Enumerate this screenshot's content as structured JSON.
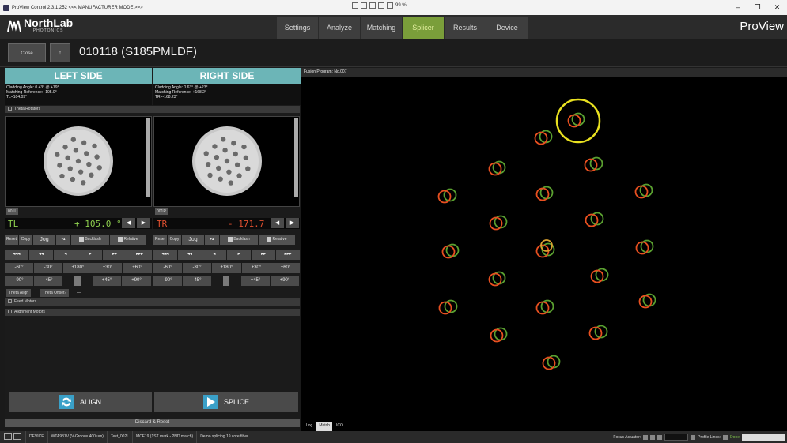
{
  "window": {
    "title": "ProView Control 2.3.1.252 <<< MANUFACTURER MODE >>>",
    "tray_text": "99 %"
  },
  "header": {
    "brand": "NorthLab",
    "brand_sub": "PHOTONICS",
    "app_name": "ProView",
    "tabs": [
      {
        "label": "Settings",
        "active": false
      },
      {
        "label": "Analyze",
        "active": false
      },
      {
        "label": "Matching",
        "active": false
      },
      {
        "label": "Splicer",
        "active": true
      },
      {
        "label": "Results",
        "active": false
      },
      {
        "label": "Device",
        "active": false
      }
    ]
  },
  "subheader": {
    "close_label": "Close",
    "up_label": "↑",
    "fiber_title": "010118 (S185PMLDF)"
  },
  "left": {
    "header": "LEFT SIDE",
    "info": [
      "Cladding Angle: 0.43° @ +19°",
      "Matching Reference: -105.0°",
      "TL=104.09°"
    ],
    "cam_label": "001L",
    "axis": "TL",
    "value": "+ 105.0 °",
    "value_color": "#8fd14f"
  },
  "right": {
    "header": "RIGHT SIDE",
    "info": [
      "Cladding Angle: 0.63° @ +23°",
      "Matching Reference: +168.2°",
      "TR=-168.23°"
    ],
    "cam_label": "001R",
    "axis": "TR",
    "value": "- 171.7 °",
    "value_color": "#e05030"
  },
  "theta_rotators": "Theta Rotators",
  "controls": {
    "reset": "Reset",
    "copy": "Copy",
    "jog": "Jog",
    "backlash": "Backlash",
    "relative": "Relative",
    "steps": [
      "◂◂◂",
      "◂◂",
      "◂",
      "▸",
      "▸▸",
      "▸▸▸"
    ],
    "row_a": [
      "-60°",
      "-30°",
      "±180°",
      "+30°",
      "+60°"
    ],
    "row_b": [
      "-90°",
      "-45°",
      "",
      "+45°",
      "+90°"
    ]
  },
  "theta_tabs": [
    "Theta Align",
    "Theta Offset?",
    "—"
  ],
  "feed_motors": "Feed Motors",
  "alignment_motors": "Alignment Motors",
  "buttons": {
    "align": "ALIGN",
    "splice": "SPLICE",
    "discard": "Discard & Reset"
  },
  "fusion": {
    "program": "Fusion Program:  No.007",
    "tabs": [
      "Log",
      "Match",
      "ICO"
    ],
    "active_tab": "Match"
  },
  "status": {
    "device_label": "DEVICE",
    "device": "WTA931V (V-Groove 400 um)",
    "test": "Test_002L",
    "mcf": "MCF19 (1ST mark - 2ND match)",
    "message": "Demo splicing 19 core fiber.",
    "focus_label": "Focus Actuator:",
    "profile_label": "Profile Lines:",
    "done_label": "Done"
  },
  "colors": {
    "accent": "#7a9e3a",
    "side_header": "#6cb5b7",
    "highlight_ring": "#e8e020",
    "red_ring": "#e85020",
    "green_ring": "#5aa030"
  }
}
